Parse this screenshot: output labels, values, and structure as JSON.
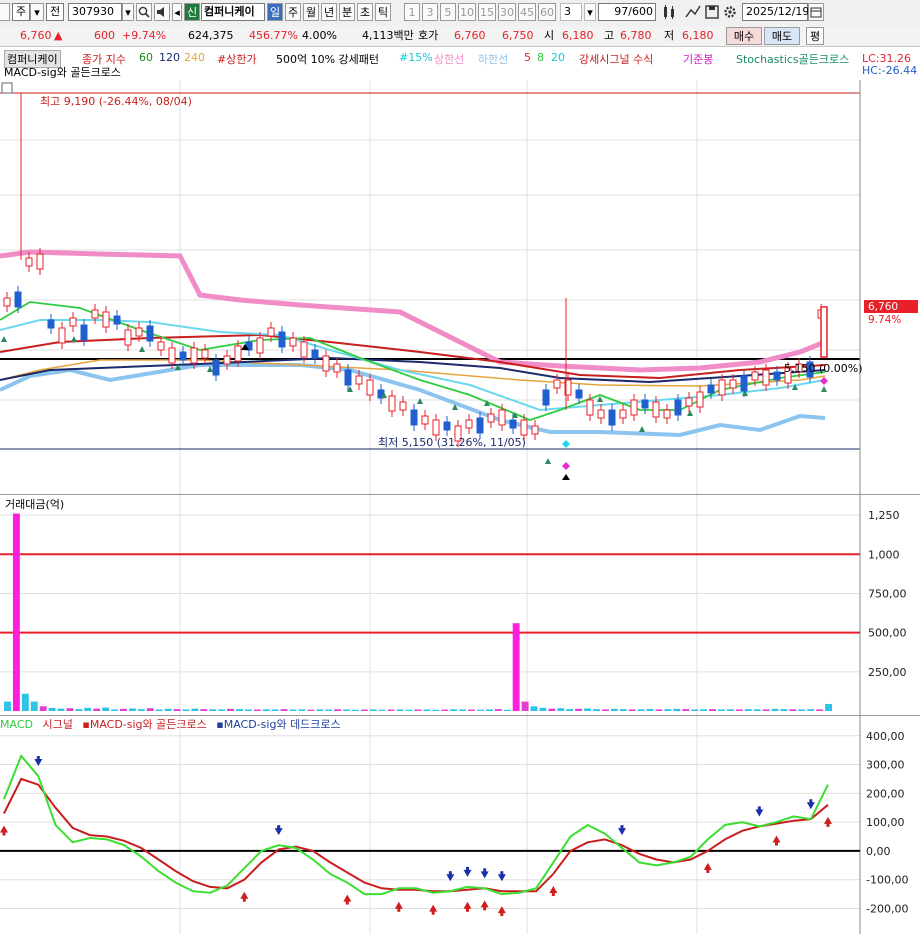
{
  "toolbar": {
    "code_type": "주",
    "market": "전",
    "code": "307930",
    "market_badge": "신",
    "name": "컴퍼니케이",
    "periods": [
      "일",
      "주",
      "월",
      "년",
      "분",
      "초",
      "틱"
    ],
    "active_period": "일",
    "intervals": [
      "1",
      "3",
      "5",
      "10",
      "15",
      "30",
      "45",
      "60"
    ],
    "interval_value": "3",
    "count": "97",
    "count_total": "/600",
    "date": "2025/12/19"
  },
  "quote": {
    "price": "6,760",
    "change_arrow": "▲",
    "change": "600",
    "change_pct": "+9.74%",
    "volume": "624,375",
    "volume_ratio": "456.77%",
    "turnover": "4.00%",
    "amount": "4,113백만",
    "hoga_label": "호가",
    "hoga": "6,760",
    "hoga2": "6,750",
    "open_label": "시",
    "open": "6,180",
    "high_label": "고",
    "high": "6,780",
    "low_label": "저",
    "low": "6,180",
    "buy_label": "매수",
    "sell_label": "매도",
    "eval_label": "평"
  },
  "legend": {
    "name": "컴퍼니케이",
    "ma_label": "종가 지수",
    "ma60": "60",
    "ma120": "120",
    "ma240": "240",
    "upper_limit": "#상한가",
    "filter": "500억 10% 강세패턴",
    "pct15": "#15%",
    "upper_line": "상한선",
    "lower_line": "하한선",
    "ma5": "5",
    "ma8": "8",
    "ma20": "20",
    "strong_signal": "강세시그널 수식",
    "base_bar": "기준봉",
    "stoch": "Stochastics골든크로스",
    "macd_gc": "MACD-sig와 골든크로스",
    "lc": "LC:31.26",
    "hc": "HC:-26.44"
  },
  "price_chart": {
    "high_note": "최고 9,190 (-26.44%, 08/04)",
    "low_note": "최저 5,150 (31.26%, 11/05)",
    "last_price": "6,760",
    "last_pct": "9.74%",
    "line_label": "5,150 (0.00%)",
    "colors": {
      "up": "#e8202a",
      "down": "#1f5fd0",
      "pink": "#f08cc8",
      "cyan": "#6bd8f0",
      "green": "#2ecc40",
      "red": "#c81e1e",
      "navy": "#1a2a6c",
      "orange": "#e8a23a",
      "lightblue": "#8cc4f0"
    }
  },
  "volume_chart": {
    "title": "거래대금(억)",
    "ticks": [
      "1,250",
      "1,000",
      "750,00",
      "500,00",
      "250,00"
    ],
    "tick_values": [
      1250,
      1000,
      750,
      500,
      250
    ],
    "ref_lines": [
      1000,
      500
    ],
    "ymax": 1340,
    "bars": [
      60,
      1260,
      110,
      60,
      30,
      20,
      15,
      18,
      12,
      20,
      15,
      22,
      10,
      14,
      16,
      12,
      18,
      10,
      14,
      12,
      10,
      15,
      12,
      11,
      10,
      14,
      12,
      10,
      9,
      11,
      10,
      12,
      9,
      10,
      8,
      10,
      9,
      11,
      10,
      8,
      9,
      10,
      8,
      9,
      10,
      8,
      9,
      10,
      8,
      9,
      11,
      10,
      9,
      8,
      10,
      12,
      8,
      560,
      60,
      30,
      20,
      15,
      18,
      12,
      14,
      16,
      12,
      10,
      14,
      12,
      10,
      11,
      13,
      10,
      12,
      14,
      12,
      10,
      11,
      12,
      10,
      11,
      10,
      12,
      11,
      10,
      14,
      12,
      11,
      10,
      12,
      10,
      45
    ],
    "spikes": [
      {
        "i": 1,
        "v": 1260
      },
      {
        "i": 57,
        "v": 560
      }
    ]
  },
  "macd_chart": {
    "legend": [
      "MACD",
      "시그널",
      "MACD-sig와 골든크로스",
      "MACD-sig와 데드크로스"
    ],
    "ticks": [
      "400,00",
      "300,00",
      "200,00",
      "100,00",
      "0,00",
      "-100,00",
      "-200,00"
    ],
    "tick_values": [
      400,
      300,
      200,
      100,
      0,
      -100,
      -200
    ],
    "ymin": -240,
    "ymax": 420,
    "macd": [
      180,
      330,
      260,
      90,
      30,
      45,
      40,
      20,
      -20,
      -70,
      -110,
      -140,
      -145,
      -120,
      -60,
      0,
      20,
      10,
      -30,
      -80,
      -110,
      -150,
      -150,
      -130,
      -130,
      -145,
      -140,
      -125,
      -130,
      -150,
      -145,
      -130,
      -40,
      50,
      90,
      60,
      10,
      -40,
      -50,
      -40,
      -20,
      40,
      90,
      100,
      85,
      100,
      120,
      110,
      230
    ],
    "signal": [
      130,
      250,
      230,
      150,
      80,
      55,
      50,
      35,
      10,
      -30,
      -70,
      -105,
      -125,
      -130,
      -100,
      -40,
      5,
      15,
      0,
      -40,
      -75,
      -110,
      -130,
      -135,
      -135,
      -140,
      -140,
      -135,
      -130,
      -140,
      -140,
      -140,
      -80,
      0,
      30,
      40,
      20,
      -10,
      -30,
      -40,
      -30,
      0,
      40,
      70,
      85,
      95,
      105,
      110,
      160
    ],
    "golden": [
      0,
      14,
      20,
      23,
      25,
      27,
      28,
      29,
      32,
      41,
      45,
      48
    ],
    "dead": [
      2,
      16,
      26,
      27,
      28,
      29,
      36,
      44,
      47
    ]
  }
}
